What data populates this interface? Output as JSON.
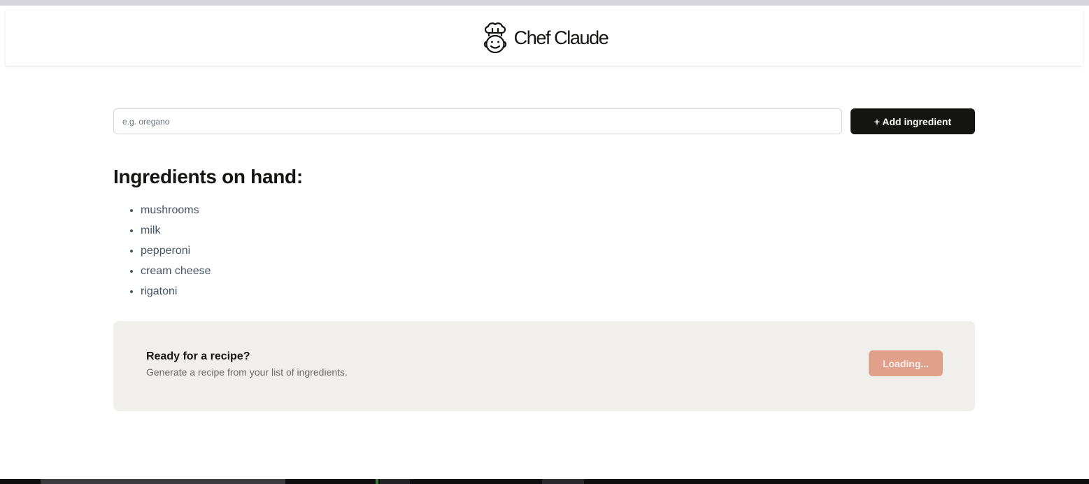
{
  "header": {
    "icon": "chef-hat-icon",
    "title": "Chef Claude"
  },
  "form": {
    "input_placeholder": "e.g. oregano",
    "input_value": "",
    "add_button_label": "+ Add ingredient"
  },
  "ingredients": {
    "heading": "Ingredients on hand:",
    "items": [
      "mushrooms",
      "milk",
      "pepperoni",
      "cream cheese",
      "rigatoni"
    ]
  },
  "recipe_cta": {
    "title": "Ready for a recipe?",
    "subtitle": "Generate a recipe from your list of ingredients.",
    "button_label": "Loading..."
  },
  "colors": {
    "primary_dark": "#141413",
    "accent_loading": "#e0a08a",
    "card_background": "#f0efeb",
    "list_text": "#475467"
  }
}
